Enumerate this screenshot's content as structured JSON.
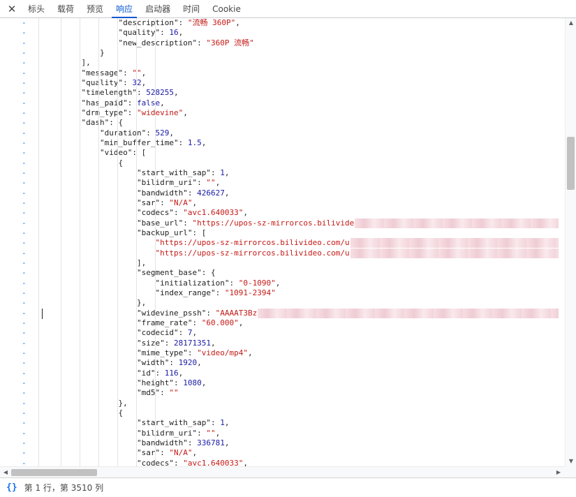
{
  "tabs": {
    "close_icon": "✕",
    "items": [
      {
        "label": "标头",
        "active": false
      },
      {
        "label": "载荷",
        "active": false
      },
      {
        "label": "预览",
        "active": false
      },
      {
        "label": "响应",
        "active": true
      },
      {
        "label": "启动器",
        "active": false
      },
      {
        "label": "时间",
        "active": false
      },
      {
        "label": "Cookie",
        "active": false
      }
    ]
  },
  "code": {
    "diff_marker": "-",
    "lines": [
      {
        "indent": 4,
        "parts": [
          [
            "k",
            "\"description\""
          ],
          [
            "p",
            ": "
          ],
          [
            "s",
            "\"流畅 360P\""
          ],
          [
            "p",
            ","
          ]
        ]
      },
      {
        "indent": 4,
        "parts": [
          [
            "k",
            "\"quality\""
          ],
          [
            "p",
            ": "
          ],
          [
            "n",
            "16"
          ],
          [
            "p",
            ","
          ]
        ]
      },
      {
        "indent": 4,
        "parts": [
          [
            "k",
            "\"new_description\""
          ],
          [
            "p",
            ": "
          ],
          [
            "s",
            "\"360P 流畅\""
          ]
        ]
      },
      {
        "indent": 3,
        "parts": [
          [
            "p",
            "}"
          ]
        ]
      },
      {
        "indent": 2,
        "parts": [
          [
            "p",
            "],"
          ]
        ]
      },
      {
        "indent": 2,
        "parts": [
          [
            "k",
            "\"message\""
          ],
          [
            "p",
            ": "
          ],
          [
            "s",
            "\"\""
          ],
          [
            "p",
            ","
          ]
        ]
      },
      {
        "indent": 2,
        "parts": [
          [
            "k",
            "\"quality\""
          ],
          [
            "p",
            ": "
          ],
          [
            "n",
            "32"
          ],
          [
            "p",
            ","
          ]
        ]
      },
      {
        "indent": 2,
        "parts": [
          [
            "k",
            "\"timelength\""
          ],
          [
            "p",
            ": "
          ],
          [
            "n",
            "528255"
          ],
          [
            "p",
            ","
          ]
        ]
      },
      {
        "indent": 2,
        "parts": [
          [
            "k",
            "\"has_paid\""
          ],
          [
            "p",
            ": "
          ],
          [
            "b",
            "false"
          ],
          [
            "p",
            ","
          ]
        ]
      },
      {
        "indent": 2,
        "parts": [
          [
            "k",
            "\"drm_type\""
          ],
          [
            "p",
            ": "
          ],
          [
            "s",
            "\"widevine\""
          ],
          [
            "p",
            ","
          ]
        ]
      },
      {
        "indent": 2,
        "parts": [
          [
            "k",
            "\"dash\""
          ],
          [
            "p",
            ": {"
          ]
        ]
      },
      {
        "indent": 3,
        "parts": [
          [
            "k",
            "\"duration\""
          ],
          [
            "p",
            ": "
          ],
          [
            "n",
            "529"
          ],
          [
            "p",
            ","
          ]
        ]
      },
      {
        "indent": 3,
        "parts": [
          [
            "k",
            "\"min_buffer_time\""
          ],
          [
            "p",
            ": "
          ],
          [
            "n",
            "1.5"
          ],
          [
            "p",
            ","
          ]
        ]
      },
      {
        "indent": 3,
        "parts": [
          [
            "k",
            "\"video\""
          ],
          [
            "p",
            ": ["
          ]
        ]
      },
      {
        "indent": 4,
        "parts": [
          [
            "p",
            "{"
          ]
        ]
      },
      {
        "indent": 5,
        "parts": [
          [
            "k",
            "\"start_with_sap\""
          ],
          [
            "p",
            ": "
          ],
          [
            "n",
            "1"
          ],
          [
            "p",
            ","
          ]
        ]
      },
      {
        "indent": 5,
        "parts": [
          [
            "k",
            "\"bilidrm_uri\""
          ],
          [
            "p",
            ": "
          ],
          [
            "s",
            "\"\""
          ],
          [
            "p",
            ","
          ]
        ]
      },
      {
        "indent": 5,
        "parts": [
          [
            "k",
            "\"bandwidth\""
          ],
          [
            "p",
            ": "
          ],
          [
            "n",
            "426627"
          ],
          [
            "p",
            ","
          ]
        ]
      },
      {
        "indent": 5,
        "parts": [
          [
            "k",
            "\"sar\""
          ],
          [
            "p",
            ": "
          ],
          [
            "s",
            "\"N/A\""
          ],
          [
            "p",
            ","
          ]
        ]
      },
      {
        "indent": 5,
        "parts": [
          [
            "k",
            "\"codecs\""
          ],
          [
            "p",
            ": "
          ],
          [
            "s",
            "\"avc1.640033\""
          ],
          [
            "p",
            ","
          ]
        ]
      },
      {
        "indent": 5,
        "parts": [
          [
            "k",
            "\"base_url\""
          ],
          [
            "p",
            ": "
          ],
          [
            "s",
            "\"https://upos-sz-mirrorcos.bilivide"
          ]
        ],
        "redacted": true
      },
      {
        "indent": 5,
        "parts": [
          [
            "k",
            "\"backup_url\""
          ],
          [
            "p",
            ": ["
          ]
        ]
      },
      {
        "indent": 6,
        "parts": [
          [
            "s",
            "\"https://upos-sz-mirrorcos.bilivideo.com/u"
          ]
        ],
        "redacted": true
      },
      {
        "indent": 6,
        "parts": [
          [
            "s",
            "\"https://upos-sz-mirrorcos.bilivideo.com/u"
          ]
        ],
        "redacted": true
      },
      {
        "indent": 5,
        "parts": [
          [
            "p",
            "],"
          ]
        ]
      },
      {
        "indent": 5,
        "parts": [
          [
            "k",
            "\"segment_base\""
          ],
          [
            "p",
            ": {"
          ]
        ]
      },
      {
        "indent": 6,
        "parts": [
          [
            "k",
            "\"initialization\""
          ],
          [
            "p",
            ": "
          ],
          [
            "s",
            "\"0-1090\""
          ],
          [
            "p",
            ","
          ]
        ]
      },
      {
        "indent": 6,
        "parts": [
          [
            "k",
            "\"index_range\""
          ],
          [
            "p",
            ": "
          ],
          [
            "s",
            "\"1091-2394\""
          ]
        ]
      },
      {
        "indent": 5,
        "parts": [
          [
            "p",
            "},"
          ]
        ]
      },
      {
        "indent": 5,
        "parts": [
          [
            "k",
            "\"widevine_pssh\""
          ],
          [
            "p",
            ": "
          ],
          [
            "s",
            "\"AAAAT3Bz"
          ]
        ],
        "redacted": true,
        "cursor": true
      },
      {
        "indent": 5,
        "parts": [
          [
            "k",
            "\"frame_rate\""
          ],
          [
            "p",
            ": "
          ],
          [
            "s",
            "\"60.000\""
          ],
          [
            "p",
            ","
          ]
        ]
      },
      {
        "indent": 5,
        "parts": [
          [
            "k",
            "\"codecid\""
          ],
          [
            "p",
            ": "
          ],
          [
            "n",
            "7"
          ],
          [
            "p",
            ","
          ]
        ]
      },
      {
        "indent": 5,
        "parts": [
          [
            "k",
            "\"size\""
          ],
          [
            "p",
            ": "
          ],
          [
            "n",
            "28171351"
          ],
          [
            "p",
            ","
          ]
        ]
      },
      {
        "indent": 5,
        "parts": [
          [
            "k",
            "\"mime_type\""
          ],
          [
            "p",
            ": "
          ],
          [
            "s",
            "\"video/mp4\""
          ],
          [
            "p",
            ","
          ]
        ]
      },
      {
        "indent": 5,
        "parts": [
          [
            "k",
            "\"width\""
          ],
          [
            "p",
            ": "
          ],
          [
            "n",
            "1920"
          ],
          [
            "p",
            ","
          ]
        ]
      },
      {
        "indent": 5,
        "parts": [
          [
            "k",
            "\"id\""
          ],
          [
            "p",
            ": "
          ],
          [
            "n",
            "116"
          ],
          [
            "p",
            ","
          ]
        ]
      },
      {
        "indent": 5,
        "parts": [
          [
            "k",
            "\"height\""
          ],
          [
            "p",
            ": "
          ],
          [
            "n",
            "1080"
          ],
          [
            "p",
            ","
          ]
        ]
      },
      {
        "indent": 5,
        "parts": [
          [
            "k",
            "\"md5\""
          ],
          [
            "p",
            ": "
          ],
          [
            "s",
            "\"\""
          ]
        ]
      },
      {
        "indent": 4,
        "parts": [
          [
            "p",
            "},"
          ]
        ]
      },
      {
        "indent": 4,
        "parts": [
          [
            "p",
            "{"
          ]
        ]
      },
      {
        "indent": 5,
        "parts": [
          [
            "k",
            "\"start_with_sap\""
          ],
          [
            "p",
            ": "
          ],
          [
            "n",
            "1"
          ],
          [
            "p",
            ","
          ]
        ]
      },
      {
        "indent": 5,
        "parts": [
          [
            "k",
            "\"bilidrm_uri\""
          ],
          [
            "p",
            ": "
          ],
          [
            "s",
            "\"\""
          ],
          [
            "p",
            ","
          ]
        ]
      },
      {
        "indent": 5,
        "parts": [
          [
            "k",
            "\"bandwidth\""
          ],
          [
            "p",
            ": "
          ],
          [
            "n",
            "336781"
          ],
          [
            "p",
            ","
          ]
        ]
      },
      {
        "indent": 5,
        "parts": [
          [
            "k",
            "\"sar\""
          ],
          [
            "p",
            ": "
          ],
          [
            "s",
            "\"N/A\""
          ],
          [
            "p",
            ","
          ]
        ]
      },
      {
        "indent": 5,
        "parts": [
          [
            "k",
            "\"codecs\""
          ],
          [
            "p",
            ": "
          ],
          [
            "s",
            "\"avc1.640033\""
          ],
          [
            "p",
            ","
          ]
        ]
      }
    ]
  },
  "scrollbars": {
    "up_icon": "▲",
    "down_icon": "▼",
    "left_icon": "◀",
    "right_icon": "▶"
  },
  "status": {
    "format_icon": "{}",
    "position_text": "第 1 行，第 3510 列"
  }
}
